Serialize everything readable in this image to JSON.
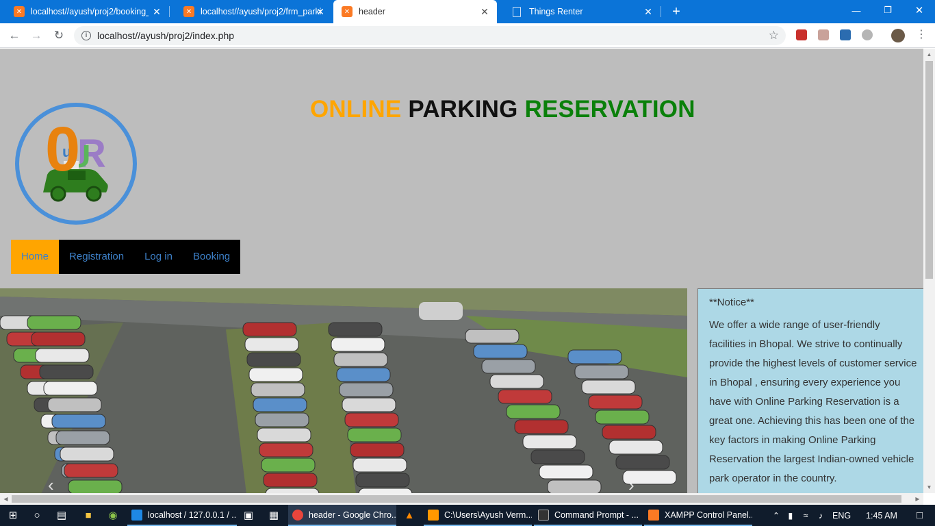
{
  "browser": {
    "tabs": [
      {
        "title": "localhost//ayush/proj2/booking_",
        "icon": "xampp-icon"
      },
      {
        "title": "localhost//ayush/proj2/frm_parki",
        "icon": "xampp-icon"
      },
      {
        "title": "header",
        "icon": "xampp-icon",
        "active": true
      },
      {
        "title": "Things Renter",
        "icon": "document-icon"
      }
    ],
    "url": "localhost//ayush/proj2/index.php",
    "new_tab_glyph": "+",
    "close_glyph": "✕"
  },
  "site": {
    "title_part1": "ONLINE",
    "title_part2": "PARKING",
    "title_part3": "RESERVATION",
    "title_colors": [
      "#ffa500",
      "#111111",
      "#0a800a"
    ],
    "menu": [
      {
        "label": "Home",
        "active": true
      },
      {
        "label": "Registration"
      },
      {
        "label": "Log in"
      },
      {
        "label": "Booking"
      }
    ],
    "notice_title": "**Notice**",
    "notice_text": "We offer a wide range of user-friendly facilities in Bhopal. We strive to continually provide the highest levels of customer service in Bhopal , ensuring every experience you have with Online Parking Reservation is a great one. Achieving this has been one of the key factors in making Online Parking Reservation the largest Indian-owned vehicle park operator in the country.",
    "colors": {
      "background": "#bdbdbd",
      "accent": "#ffa500",
      "menu_bg": "#000000",
      "notice_bg": "#add8e6"
    }
  },
  "taskbar": {
    "items": [
      {
        "label": "localhost / 127.0.0.1 / ...",
        "icon": "edge-icon"
      },
      {
        "label": "header - Google Chro...",
        "icon": "chrome-icon",
        "active": true
      },
      {
        "label": "C:\\Users\\Ayush Verm...",
        "icon": "sublime-icon"
      },
      {
        "label": "Command Prompt - ...",
        "icon": "cmd-icon"
      },
      {
        "label": "XAMPP Control Panel...",
        "icon": "xampp-icon"
      }
    ],
    "language": "ENG",
    "time": "1:45 AM"
  }
}
